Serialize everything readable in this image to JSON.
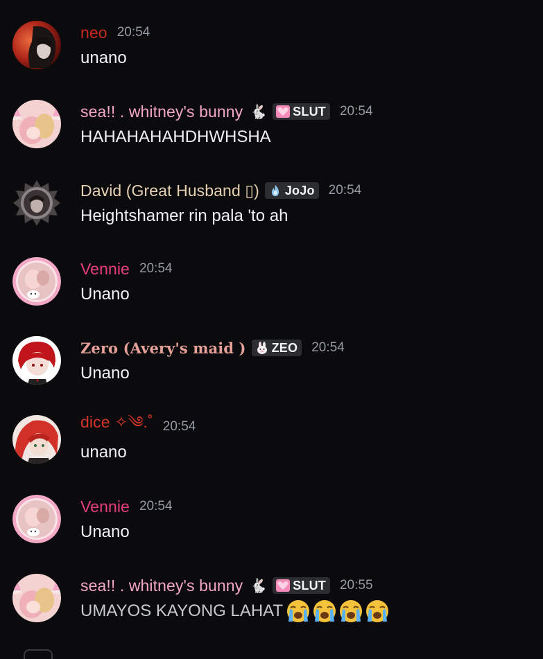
{
  "messages": [
    {
      "author": "neo",
      "author_color": "#c8281f",
      "time": "20:54",
      "text": "unano",
      "avatar_icon": "dark-anime-avatar-red-moon"
    },
    {
      "author": "sea!! . whitney's bunny",
      "author_color": "#f4a6c6",
      "name_deco": "🐇",
      "tag": "SLUT",
      "tag_icon": "pink-heart-icon",
      "time": "20:54",
      "text": "HAHAHAHAHDHWHSHA",
      "avatar_icon": "pink-cat-ears-avatar"
    },
    {
      "author": "David (Great Husband ▯)",
      "author_color": "#e7d1b3",
      "tag": "JoJo",
      "tag_icon": "blue-flame-icon",
      "time": "20:54",
      "text": "Heightshamer rin pala 'to ah",
      "avatar_icon": "spiked-frame-avatar"
    },
    {
      "author": "Vennie",
      "author_color": "#e7407a",
      "time": "20:54",
      "text": "Unano",
      "avatar_icon": "pink-framed-avatar"
    },
    {
      "author": "Zero (Avery's maid )",
      "author_color": "#e5a199",
      "tag": "ZEO",
      "tag_icon": "bunny-icon",
      "time": "20:54",
      "text": "Unano",
      "avatar_icon": "red-hair-avatar"
    },
    {
      "author": "dice ✧༄.˚",
      "author_color": "#d4352b",
      "time": "20:54",
      "text": "unano",
      "avatar_icon": "red-hair-girl-avatar"
    },
    {
      "author": "Vennie",
      "author_color": "#e7407a",
      "time": "20:54",
      "text": "Unano",
      "avatar_icon": "pink-framed-avatar"
    },
    {
      "author": "sea!! . whitney's bunny",
      "author_color": "#f4a6c6",
      "name_deco": "🐇",
      "tag": "SLUT",
      "tag_icon": "pink-heart-icon",
      "time": "20:55",
      "text": "UMAYOS KAYONG LAHAT",
      "emoji": [
        "loudly-crying-face-icon",
        "loudly-crying-face-icon",
        "loudly-crying-face-icon",
        "loudly-crying-face-icon"
      ],
      "avatar_icon": "pink-cat-ears-avatar"
    }
  ]
}
